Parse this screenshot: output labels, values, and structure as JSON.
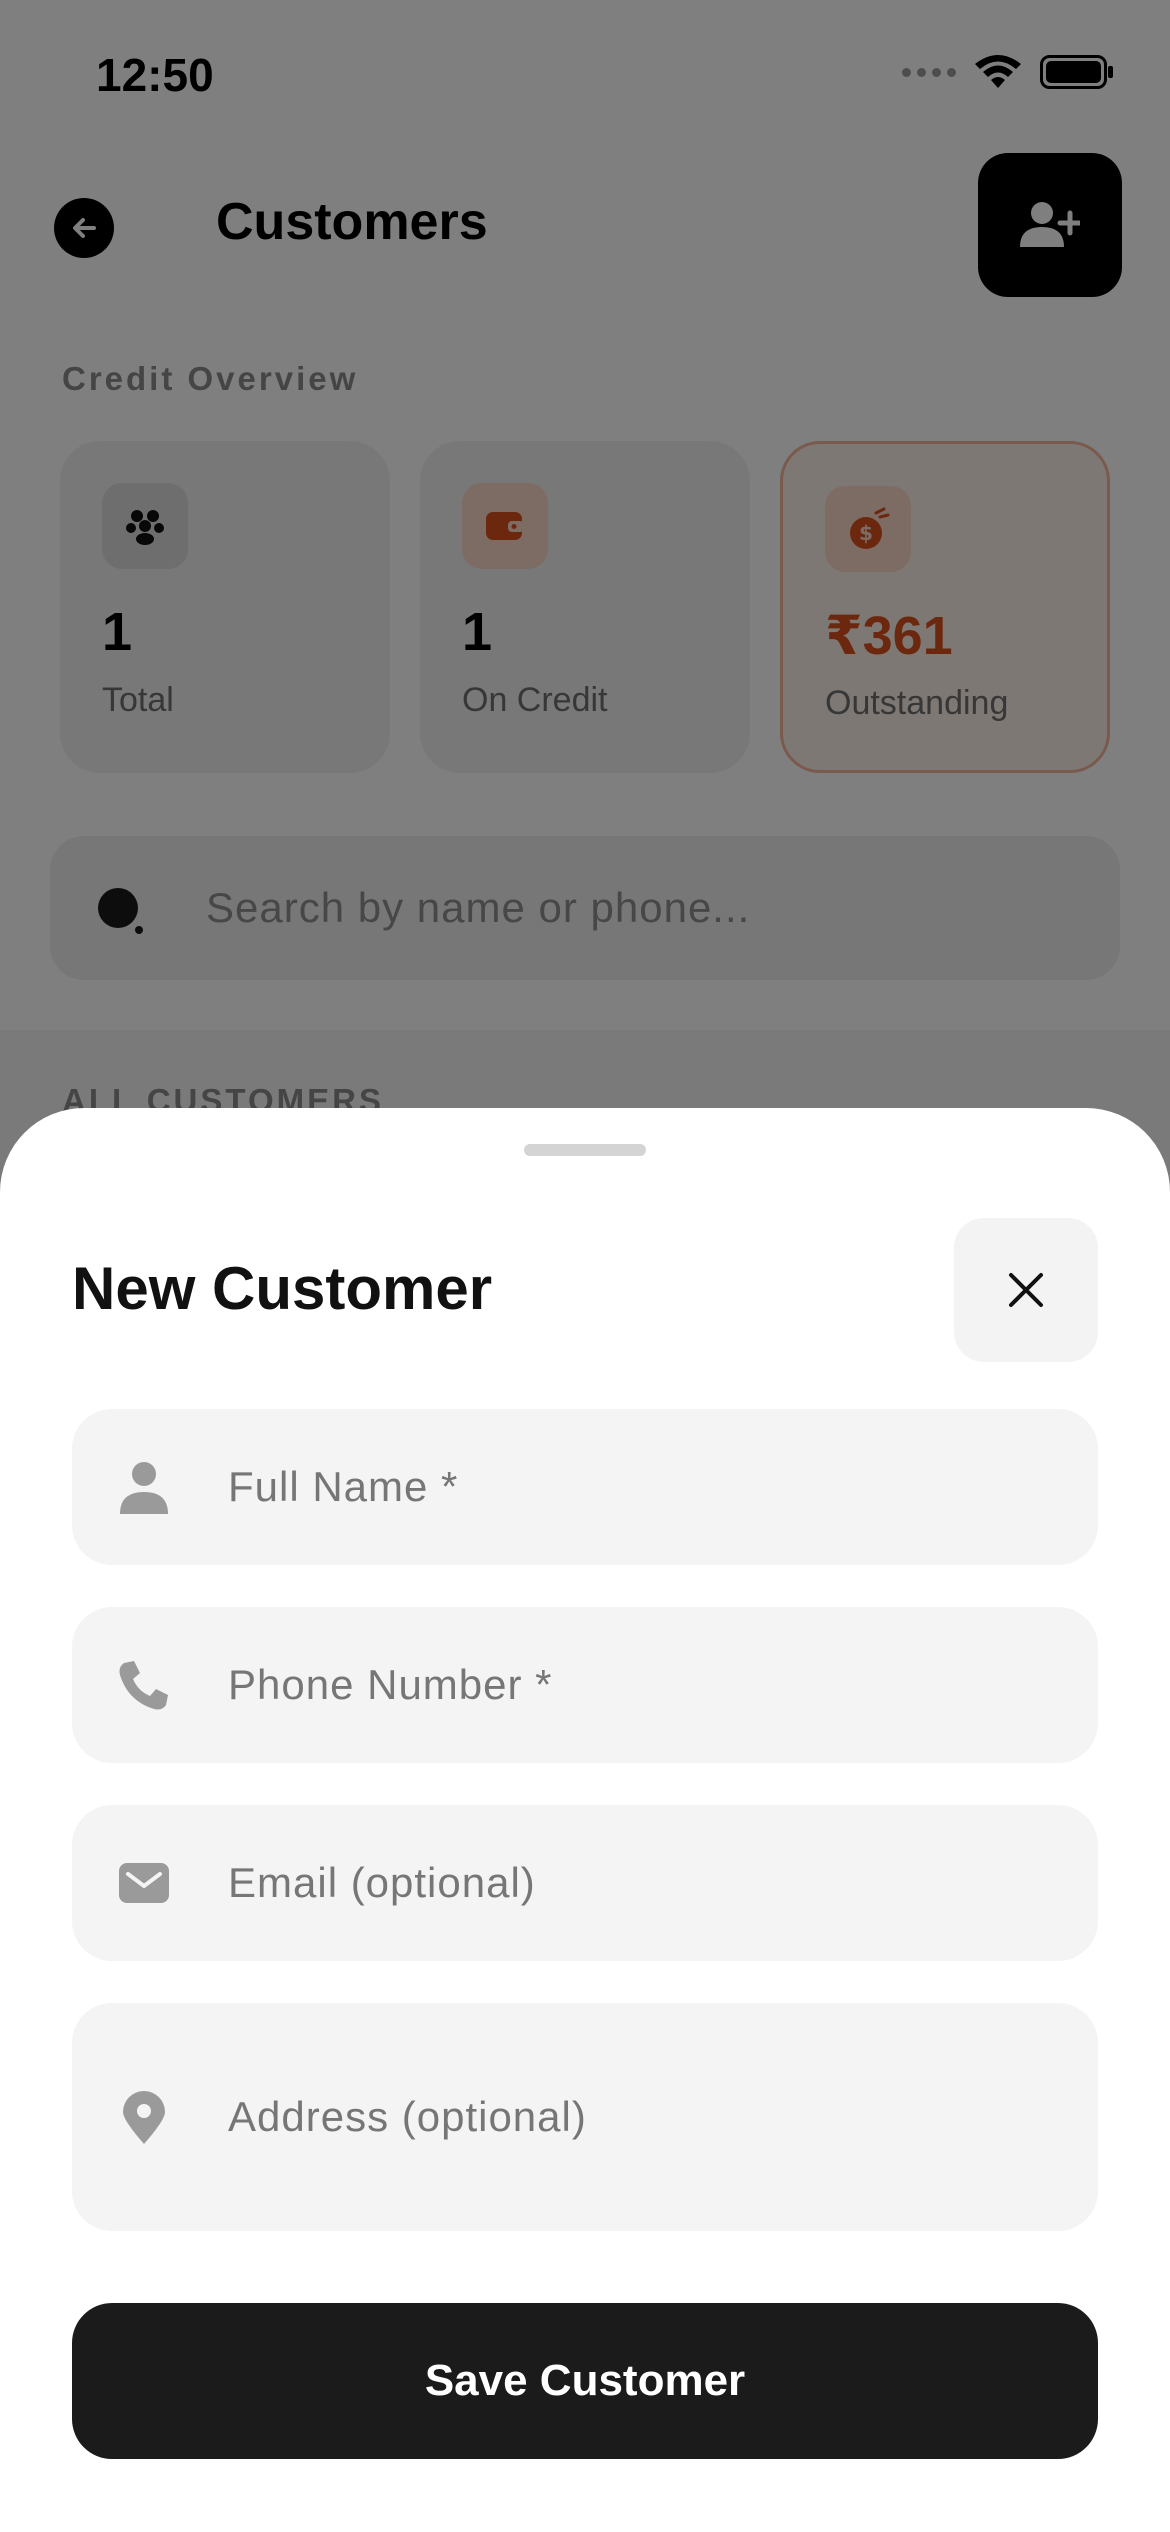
{
  "status_bar": {
    "time": "12:50"
  },
  "header": {
    "title": "Customers"
  },
  "overview": {
    "label": "Credit Overview",
    "cards": [
      {
        "value": "1",
        "label": "Total",
        "icon": "people-icon"
      },
      {
        "value": "1",
        "label": "On Credit",
        "icon": "wallet-icon"
      },
      {
        "value": "₹361",
        "label": "Outstanding",
        "icon": "money-bag-icon"
      }
    ]
  },
  "search": {
    "placeholder": "Search by name or phone..."
  },
  "list": {
    "label": "ALL CUSTOMERS"
  },
  "sheet": {
    "title": "New Customer",
    "fields": [
      {
        "placeholder": "Full Name *",
        "value": "",
        "icon": "person-icon"
      },
      {
        "placeholder": "Phone Number *",
        "value": "",
        "icon": "phone-icon"
      },
      {
        "placeholder": "Email (optional)",
        "value": "",
        "icon": "mail-icon"
      },
      {
        "placeholder": "Address (optional)",
        "value": "",
        "icon": "location-pin-icon"
      }
    ],
    "save_label": "Save Customer"
  },
  "colors": {
    "accent": "#d9501f",
    "dark": "#1b1b1b",
    "overlay": "rgba(0,0,0,0.5)"
  }
}
